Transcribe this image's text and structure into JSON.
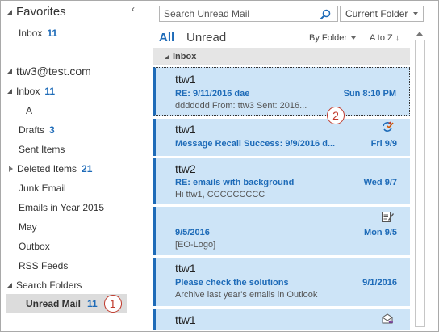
{
  "folder_pane": {
    "favorites_label": "Favorites",
    "favorites": [
      {
        "label": "Inbox",
        "count": "11"
      }
    ],
    "account": "ttw3@test.com",
    "folders": [
      {
        "label": "Inbox",
        "count": "11",
        "indent": false,
        "expander": "open"
      },
      {
        "label": "A",
        "count": "",
        "indent": true
      },
      {
        "label": "Drafts",
        "count": "3"
      },
      {
        "label": "Sent Items",
        "count": ""
      },
      {
        "label": "Deleted Items",
        "count": "21",
        "expander": "closed"
      },
      {
        "label": "Junk Email",
        "count": ""
      },
      {
        "label": "Emails in Year 2015",
        "count": ""
      },
      {
        "label": "May",
        "count": ""
      },
      {
        "label": "Outbox",
        "count": ""
      },
      {
        "label": "RSS Feeds",
        "count": ""
      },
      {
        "label": "Search Folders",
        "count": "",
        "expander": "open"
      },
      {
        "label": "Unread Mail",
        "count": "11",
        "selected": true
      }
    ],
    "step_badge": "1"
  },
  "toolbar": {
    "search_placeholder": "Search Unread Mail",
    "scope": "Current Folder",
    "tab_all": "All",
    "tab_unread": "Unread",
    "arrange": "By Folder",
    "sort": "A to Z ↓"
  },
  "mail_list": {
    "group": "Inbox",
    "step_badge": "2",
    "messages": [
      {
        "sender": "ttw1",
        "subject": "RE: 9/11/2016 dae",
        "date": "Sun 8:10 PM",
        "preview": "ddddddd From: ttw3 Sent: 2016...",
        "icon": ""
      },
      {
        "sender": "ttw1",
        "subject": "Message Recall Success: 9/9/2016 d...",
        "date": "Fri 9/9",
        "preview": "",
        "icon": "recall-success-icon"
      },
      {
        "sender": "ttw2",
        "subject": "RE: emails with background",
        "date": "Wed 9/7",
        "preview": "Hi ttw1,  CCCCCCCCC",
        "icon": ""
      },
      {
        "sender": "",
        "subject": "9/5/2016",
        "date": "Mon 9/5",
        "preview": "[EO-Logo]",
        "icon": "draft-edit-icon"
      },
      {
        "sender": "ttw1",
        "subject": "Please check the solutions",
        "date": "9/1/2016",
        "preview": "Archive last year's emails in Outlook",
        "icon": ""
      },
      {
        "sender": "ttw1",
        "subject": "",
        "date": "",
        "preview": "",
        "icon": "envelope-reply-icon"
      }
    ]
  },
  "colors": {
    "accent": "#1e6bb8",
    "selected_mail_bg": "#cde4f7",
    "badge_red": "#c0392b"
  }
}
